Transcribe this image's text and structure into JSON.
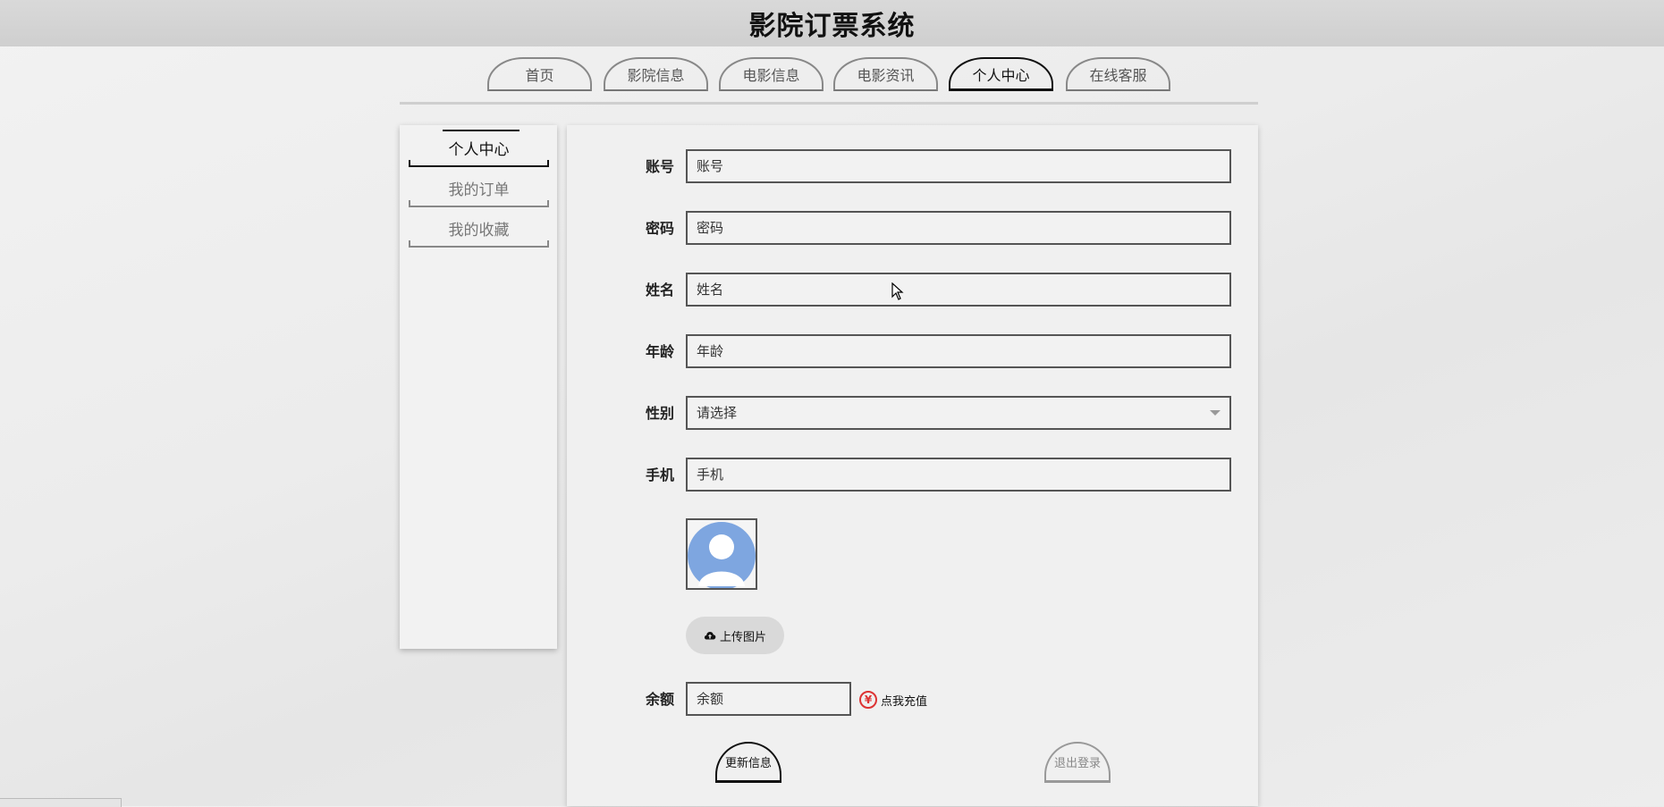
{
  "app": {
    "title": "影院订票系统"
  },
  "nav": {
    "tabs": [
      {
        "label": "首页"
      },
      {
        "label": "影院信息"
      },
      {
        "label": "电影信息"
      },
      {
        "label": "电影资讯"
      },
      {
        "label": "个人中心",
        "active": true
      },
      {
        "label": "在线客服"
      }
    ]
  },
  "sidebar": {
    "items": [
      {
        "label": "个人中心",
        "active": true
      },
      {
        "label": "我的订单"
      },
      {
        "label": "我的收藏"
      }
    ]
  },
  "form": {
    "account": {
      "label": "账号",
      "placeholder": "账号"
    },
    "password": {
      "label": "密码",
      "placeholder": "密码"
    },
    "name": {
      "label": "姓名",
      "placeholder": "姓名"
    },
    "age": {
      "label": "年龄",
      "placeholder": "年龄"
    },
    "gender": {
      "label": "性别",
      "selected": "请选择"
    },
    "phone": {
      "label": "手机",
      "placeholder": "手机"
    },
    "upload": {
      "label": "上传图片"
    },
    "balance": {
      "label": "余额",
      "placeholder": "余额"
    },
    "recharge": {
      "label": "点我充值",
      "icon": "¥"
    },
    "update_label": "更新信息",
    "logout_label": "退出登录"
  },
  "colors": {
    "avatar": "#7ea6e0",
    "recharge_icon": "#dd3333"
  }
}
